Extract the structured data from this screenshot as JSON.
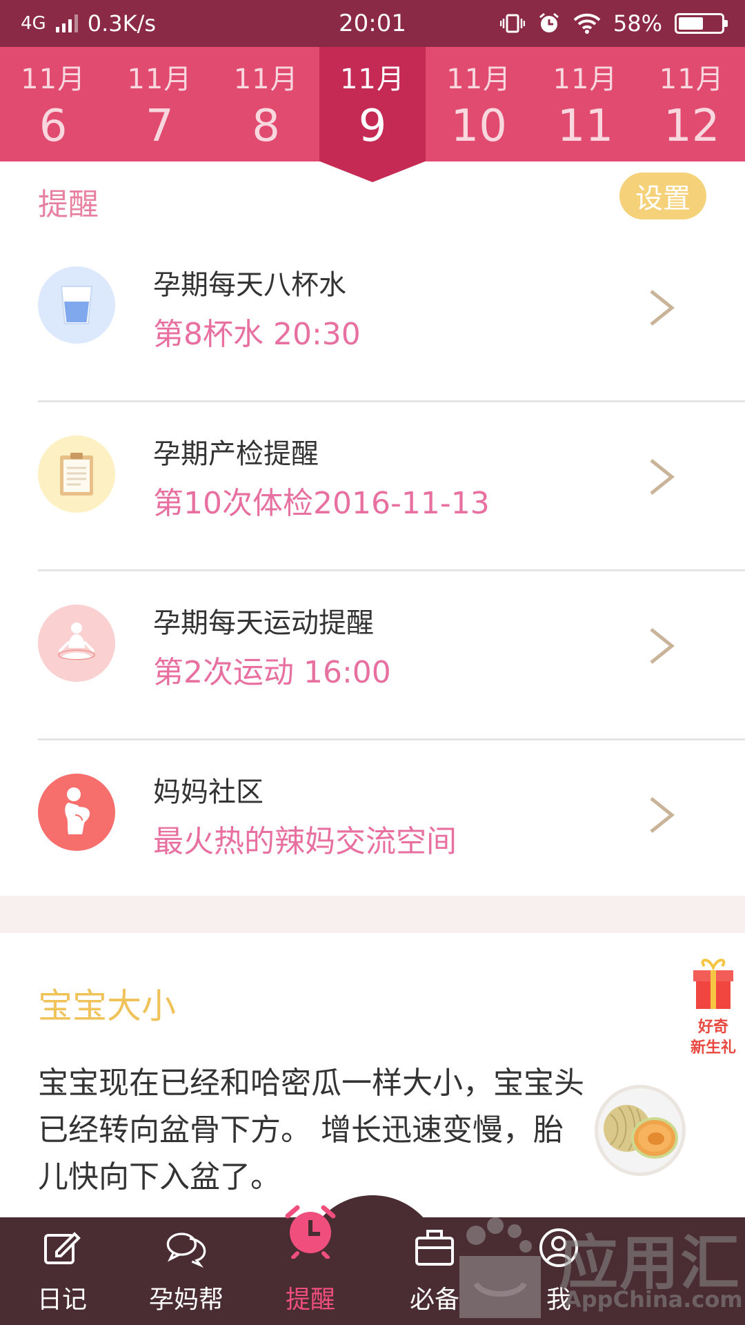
{
  "status_bar": {
    "network": "4G",
    "speed": "0.3K/s",
    "time": "20:01",
    "battery": "58%",
    "battery_level": 0.58
  },
  "date_strip": {
    "dates": [
      {
        "month": "11月",
        "day": "6"
      },
      {
        "month": "11月",
        "day": "7"
      },
      {
        "month": "11月",
        "day": "8"
      },
      {
        "month": "11月",
        "day": "9"
      },
      {
        "month": "11月",
        "day": "10"
      },
      {
        "month": "11月",
        "day": "11"
      },
      {
        "month": "11月",
        "day": "12"
      }
    ],
    "selected_day": "9"
  },
  "reminders": {
    "title": "提醒",
    "settings_label": "设置",
    "items": [
      {
        "title": "孕期每天八杯水",
        "subtitle": "第8杯水  20:30",
        "icon": "water-glass-icon",
        "icon_bg": "#dce8fb"
      },
      {
        "title": "孕期产检提醒",
        "subtitle": "第10次体检2016-11-13",
        "icon": "clipboard-icon",
        "icon_bg": "#fdf1c3"
      },
      {
        "title": "孕期每天运动提醒",
        "subtitle": "第2次运动  16:00",
        "icon": "yoga-icon",
        "icon_bg": "#fbd0d0"
      },
      {
        "title": "妈妈社区",
        "subtitle": "最火热的辣妈交流空间",
        "icon": "pregnant-mom-icon",
        "icon_bg": "#f66f6c"
      }
    ]
  },
  "baby_size": {
    "title": "宝宝大小",
    "text": "宝宝现在已经和哈密瓜一样大小，宝宝头已经转向盆骨下方。 增长迅速变慢，胎儿快向下入盆了。",
    "image": "cantaloupe-image"
  },
  "gift_badge": {
    "line1": "好奇",
    "line2": "新生礼"
  },
  "bottom_nav": {
    "items": [
      {
        "label": "日记",
        "icon": "edit-icon"
      },
      {
        "label": "孕妈帮",
        "icon": "chat-bubbles-icon"
      },
      {
        "label": "提醒",
        "icon": "alarm-clock-icon"
      },
      {
        "label": "必备",
        "icon": "briefcase-icon"
      },
      {
        "label": "我",
        "icon": "user-icon"
      }
    ],
    "active": "提醒"
  },
  "watermark": {
    "title": "应用汇",
    "subtitle": "AppChina.com"
  },
  "colors": {
    "status_bar": "#8b2a46",
    "date_strip": "#e14b70",
    "date_active": "#c42a54",
    "accent_pink": "#e770a0",
    "settings_yellow": "#f5d27a",
    "baby_title": "#f0c25a",
    "nav_bg": "#4a2c33",
    "nav_active": "#f04f7d"
  }
}
